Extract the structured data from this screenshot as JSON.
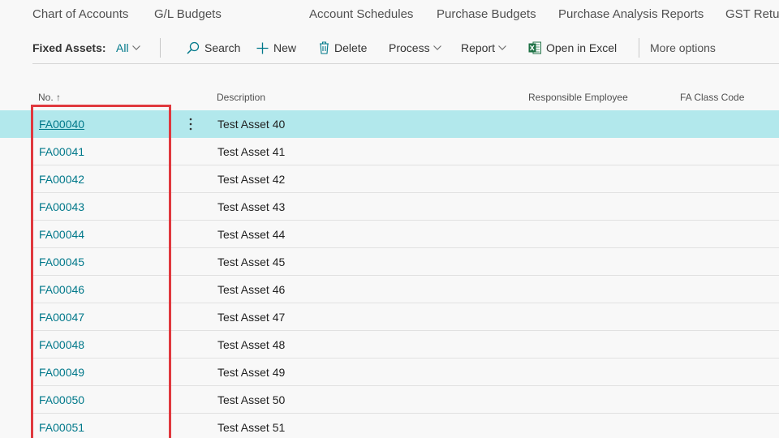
{
  "topnav": {
    "items": [
      "Chart of Accounts",
      "G/L Budgets",
      "Account Schedules",
      "Purchase Budgets",
      "Purchase Analysis Reports",
      "GST Retu"
    ]
  },
  "actionbar": {
    "filter_label": "Fixed Assets:",
    "filter_value": "All",
    "search": "Search",
    "new": "New",
    "delete": "Delete",
    "process": "Process",
    "report": "Report",
    "open_excel": "Open in Excel",
    "more_options": "More options"
  },
  "table": {
    "columns": {
      "no": "No. ↑",
      "description": "Description",
      "responsible_employee": "Responsible Employee",
      "fa_class_code": "FA Class Code"
    },
    "rows": [
      {
        "no": "FA00040",
        "description": "Test Asset 40"
      },
      {
        "no": "FA00041",
        "description": "Test Asset 41"
      },
      {
        "no": "FA00042",
        "description": "Test Asset 42"
      },
      {
        "no": "FA00043",
        "description": "Test Asset 43"
      },
      {
        "no": "FA00044",
        "description": "Test Asset 44"
      },
      {
        "no": "FA00045",
        "description": "Test Asset 45"
      },
      {
        "no": "FA00046",
        "description": "Test Asset 46"
      },
      {
        "no": "FA00047",
        "description": "Test Asset 47"
      },
      {
        "no": "FA00048",
        "description": "Test Asset 48"
      },
      {
        "no": "FA00049",
        "description": "Test Asset 49"
      },
      {
        "no": "FA00050",
        "description": "Test Asset 50"
      },
      {
        "no": "FA00051",
        "description": "Test Asset 51"
      }
    ]
  },
  "colors": {
    "accent": "#00788a",
    "selected_row": "#b2e8ec",
    "highlight_box": "#e0383e",
    "excel_green": "#1e7145"
  }
}
